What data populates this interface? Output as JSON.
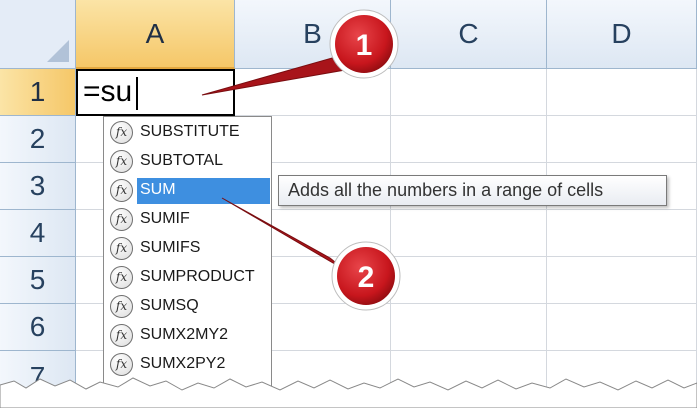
{
  "sheet": {
    "columns": [
      "A",
      "B",
      "C",
      "D"
    ],
    "rows": [
      "1",
      "2",
      "3",
      "4",
      "5",
      "6",
      "7"
    ],
    "active_column": "A",
    "active_row": "1"
  },
  "active_cell": {
    "formula": "=su"
  },
  "autocomplete": {
    "icon_glyph": "fx",
    "items": [
      "SUBSTITUTE",
      "SUBTOTAL",
      "SUM",
      "SUMIF",
      "SUMIFS",
      "SUMPRODUCT",
      "SUMSQ",
      "SUMX2MY2",
      "SUMX2PY2"
    ],
    "selected": "SUM"
  },
  "tooltip": {
    "text": "Adds all the numbers in a range of cells"
  },
  "callouts": [
    {
      "number": "1"
    },
    {
      "number": "2"
    }
  ],
  "colors": {
    "callout_red": "#c8161d",
    "selection_blue": "#3e8fe0",
    "header_highlight": "#f5c768"
  }
}
